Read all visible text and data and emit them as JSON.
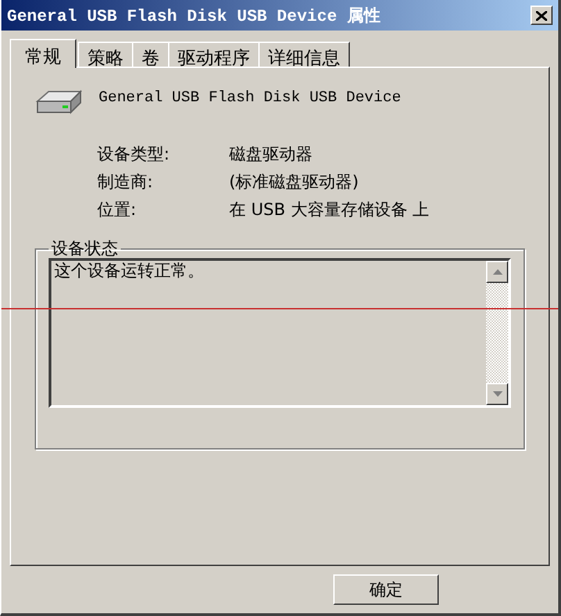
{
  "window": {
    "title": "General USB Flash Disk USB Device 属性"
  },
  "tabs": [
    {
      "label": "常规",
      "selected": true
    },
    {
      "label": "策略",
      "selected": false
    },
    {
      "label": "卷",
      "selected": false
    },
    {
      "label": "驱动程序",
      "selected": false
    },
    {
      "label": "详细信息",
      "selected": false
    }
  ],
  "device": {
    "name": "General USB Flash Disk USB Device"
  },
  "properties": [
    {
      "label": "设备类型:",
      "value": "磁盘驱动器"
    },
    {
      "label": "制造商:",
      "value": "(标准磁盘驱动器)"
    },
    {
      "label": "位置:",
      "value": "在 USB 大容量存储设备 上"
    }
  ],
  "status_group": {
    "title": "设备状态",
    "text": "这个设备运转正常。"
  },
  "buttons": [
    "确定"
  ]
}
